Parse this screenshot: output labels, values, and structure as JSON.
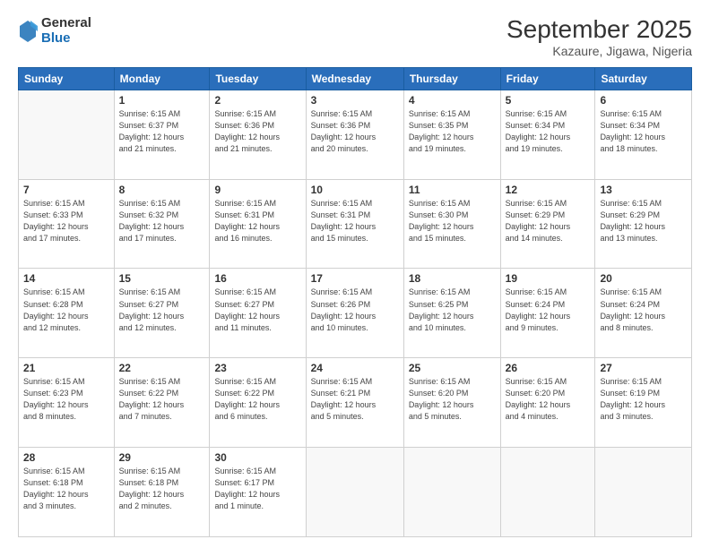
{
  "header": {
    "logo_general": "General",
    "logo_blue": "Blue",
    "title": "September 2025",
    "subtitle": "Kazaure, Jigawa, Nigeria"
  },
  "days_of_week": [
    "Sunday",
    "Monday",
    "Tuesday",
    "Wednesday",
    "Thursday",
    "Friday",
    "Saturday"
  ],
  "weeks": [
    [
      {
        "day": "",
        "info": ""
      },
      {
        "day": "1",
        "info": "Sunrise: 6:15 AM\nSunset: 6:37 PM\nDaylight: 12 hours\nand 21 minutes."
      },
      {
        "day": "2",
        "info": "Sunrise: 6:15 AM\nSunset: 6:36 PM\nDaylight: 12 hours\nand 21 minutes."
      },
      {
        "day": "3",
        "info": "Sunrise: 6:15 AM\nSunset: 6:36 PM\nDaylight: 12 hours\nand 20 minutes."
      },
      {
        "day": "4",
        "info": "Sunrise: 6:15 AM\nSunset: 6:35 PM\nDaylight: 12 hours\nand 19 minutes."
      },
      {
        "day": "5",
        "info": "Sunrise: 6:15 AM\nSunset: 6:34 PM\nDaylight: 12 hours\nand 19 minutes."
      },
      {
        "day": "6",
        "info": "Sunrise: 6:15 AM\nSunset: 6:34 PM\nDaylight: 12 hours\nand 18 minutes."
      }
    ],
    [
      {
        "day": "7",
        "info": "Sunrise: 6:15 AM\nSunset: 6:33 PM\nDaylight: 12 hours\nand 17 minutes."
      },
      {
        "day": "8",
        "info": "Sunrise: 6:15 AM\nSunset: 6:32 PM\nDaylight: 12 hours\nand 17 minutes."
      },
      {
        "day": "9",
        "info": "Sunrise: 6:15 AM\nSunset: 6:31 PM\nDaylight: 12 hours\nand 16 minutes."
      },
      {
        "day": "10",
        "info": "Sunrise: 6:15 AM\nSunset: 6:31 PM\nDaylight: 12 hours\nand 15 minutes."
      },
      {
        "day": "11",
        "info": "Sunrise: 6:15 AM\nSunset: 6:30 PM\nDaylight: 12 hours\nand 15 minutes."
      },
      {
        "day": "12",
        "info": "Sunrise: 6:15 AM\nSunset: 6:29 PM\nDaylight: 12 hours\nand 14 minutes."
      },
      {
        "day": "13",
        "info": "Sunrise: 6:15 AM\nSunset: 6:29 PM\nDaylight: 12 hours\nand 13 minutes."
      }
    ],
    [
      {
        "day": "14",
        "info": "Sunrise: 6:15 AM\nSunset: 6:28 PM\nDaylight: 12 hours\nand 12 minutes."
      },
      {
        "day": "15",
        "info": "Sunrise: 6:15 AM\nSunset: 6:27 PM\nDaylight: 12 hours\nand 12 minutes."
      },
      {
        "day": "16",
        "info": "Sunrise: 6:15 AM\nSunset: 6:27 PM\nDaylight: 12 hours\nand 11 minutes."
      },
      {
        "day": "17",
        "info": "Sunrise: 6:15 AM\nSunset: 6:26 PM\nDaylight: 12 hours\nand 10 minutes."
      },
      {
        "day": "18",
        "info": "Sunrise: 6:15 AM\nSunset: 6:25 PM\nDaylight: 12 hours\nand 10 minutes."
      },
      {
        "day": "19",
        "info": "Sunrise: 6:15 AM\nSunset: 6:24 PM\nDaylight: 12 hours\nand 9 minutes."
      },
      {
        "day": "20",
        "info": "Sunrise: 6:15 AM\nSunset: 6:24 PM\nDaylight: 12 hours\nand 8 minutes."
      }
    ],
    [
      {
        "day": "21",
        "info": "Sunrise: 6:15 AM\nSunset: 6:23 PM\nDaylight: 12 hours\nand 8 minutes."
      },
      {
        "day": "22",
        "info": "Sunrise: 6:15 AM\nSunset: 6:22 PM\nDaylight: 12 hours\nand 7 minutes."
      },
      {
        "day": "23",
        "info": "Sunrise: 6:15 AM\nSunset: 6:22 PM\nDaylight: 12 hours\nand 6 minutes."
      },
      {
        "day": "24",
        "info": "Sunrise: 6:15 AM\nSunset: 6:21 PM\nDaylight: 12 hours\nand 5 minutes."
      },
      {
        "day": "25",
        "info": "Sunrise: 6:15 AM\nSunset: 6:20 PM\nDaylight: 12 hours\nand 5 minutes."
      },
      {
        "day": "26",
        "info": "Sunrise: 6:15 AM\nSunset: 6:20 PM\nDaylight: 12 hours\nand 4 minutes."
      },
      {
        "day": "27",
        "info": "Sunrise: 6:15 AM\nSunset: 6:19 PM\nDaylight: 12 hours\nand 3 minutes."
      }
    ],
    [
      {
        "day": "28",
        "info": "Sunrise: 6:15 AM\nSunset: 6:18 PM\nDaylight: 12 hours\nand 3 minutes."
      },
      {
        "day": "29",
        "info": "Sunrise: 6:15 AM\nSunset: 6:18 PM\nDaylight: 12 hours\nand 2 minutes."
      },
      {
        "day": "30",
        "info": "Sunrise: 6:15 AM\nSunset: 6:17 PM\nDaylight: 12 hours\nand 1 minute."
      },
      {
        "day": "",
        "info": ""
      },
      {
        "day": "",
        "info": ""
      },
      {
        "day": "",
        "info": ""
      },
      {
        "day": "",
        "info": ""
      }
    ]
  ]
}
